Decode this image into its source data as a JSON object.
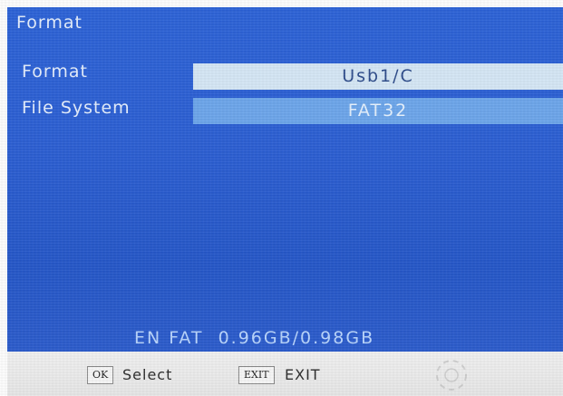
{
  "header": {
    "title": "Format"
  },
  "settings": {
    "rows": [
      {
        "label": "Format",
        "value": "Usb1/C"
      },
      {
        "label": "File System",
        "value": "FAT32"
      }
    ]
  },
  "status": {
    "lang": "EN",
    "fs": "FAT",
    "capacity": "0.96GB/0.98GB"
  },
  "footer": {
    "ok_key": "OK",
    "select_label": "Select",
    "exit_key": "EXIT",
    "exit_label": "EXIT"
  },
  "colors": {
    "panel_blue": "#2b62d8",
    "selected_field": "#d6e8f7",
    "unselected_field": "#6ca6ec",
    "footer_bg": "#f2f2f2"
  }
}
